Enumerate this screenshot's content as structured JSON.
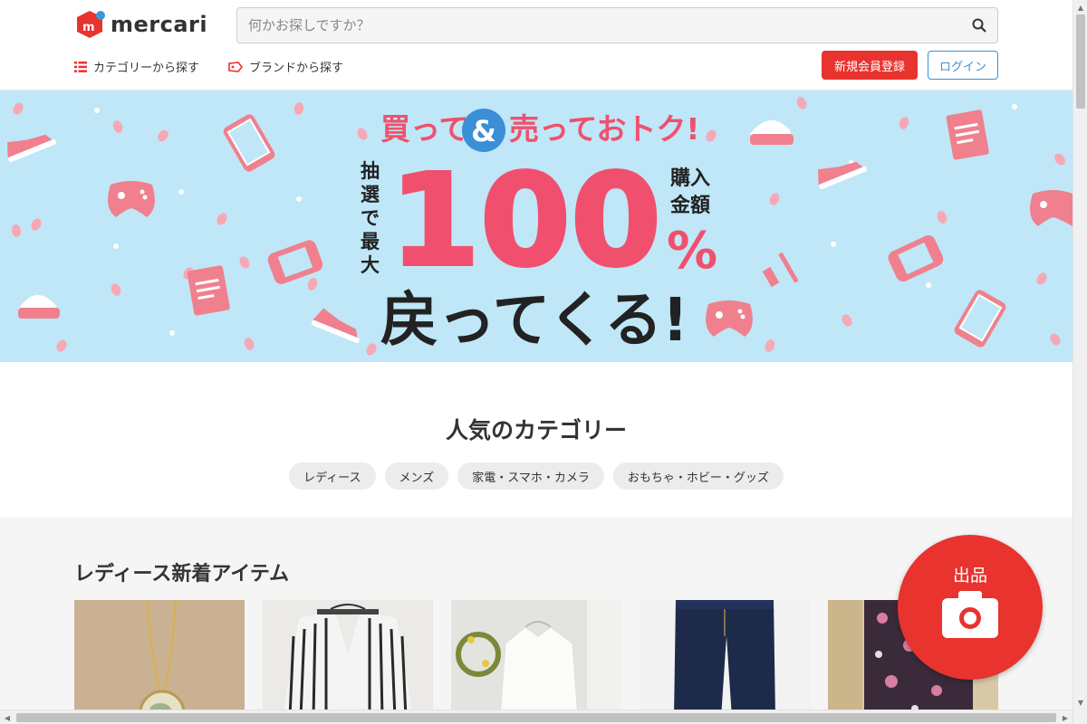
{
  "header": {
    "logo_text": "mercari",
    "search": {
      "placeholder": "何かお探しですか？",
      "value": ""
    },
    "nav": {
      "category": "カテゴリーから探す",
      "brand": "ブランドから探す"
    },
    "register_label": "新規会員登録",
    "login_label": "ログイン"
  },
  "banner": {
    "line1_a": "買って",
    "line1_amp": "&",
    "line1_b": "売っておトク!",
    "left_text": [
      "抽",
      "選",
      "で",
      "最",
      "大"
    ],
    "right_text_1": "購入",
    "right_text_2": "金額",
    "big_number": "100",
    "percent": "%",
    "bottom": "戻ってくる!"
  },
  "popular": {
    "title": "人気のカテゴリー",
    "chips": [
      "レディース",
      "メンズ",
      "家電・スマホ・カメラ",
      "おもちゃ・ホビー・グッズ"
    ]
  },
  "new_items": {
    "title": "レディース新着アイテム",
    "items": [
      "necklace",
      "striped-cardigan",
      "white-blouse",
      "denim-jeans",
      "floral-dress"
    ]
  },
  "fab": {
    "label": "出品"
  },
  "colors": {
    "brand_red": "#e8332e",
    "link_blue": "#3a8fd6",
    "banner_bg": "#bfe7f7",
    "banner_pink": "#f0506e"
  }
}
